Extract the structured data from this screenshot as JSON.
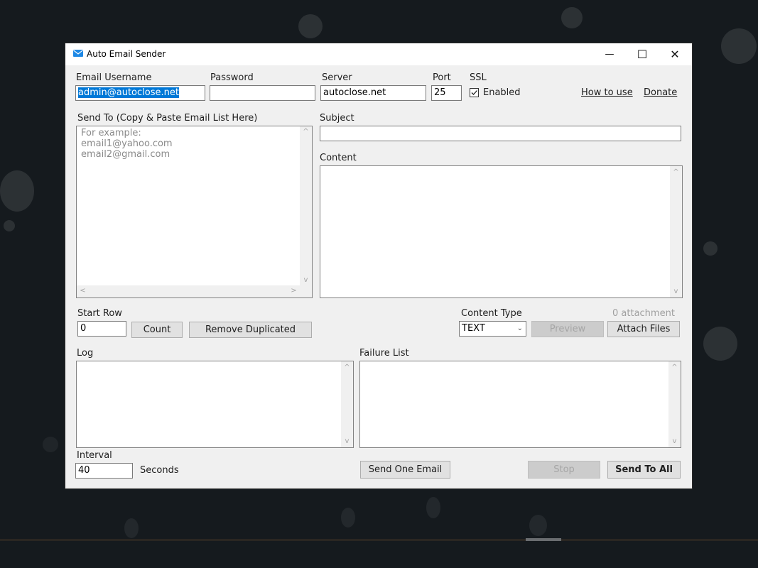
{
  "window": {
    "title": "Auto Email Sender",
    "controls": {
      "minimize": "—",
      "maximize": "☐",
      "close": "✕"
    }
  },
  "account": {
    "username_label": "Email Username",
    "username_value": "admin@autoclose.net",
    "password_label": "Password",
    "password_value": "",
    "server_label": "Server",
    "server_value": "autoclose.net",
    "port_label": "Port",
    "port_value": "25",
    "ssl_label": "SSL",
    "ssl_checkbox_label": "Enabled",
    "ssl_checked": true
  },
  "links": {
    "how_to_use": "How to use",
    "donate": "Donate"
  },
  "send_to": {
    "label": "Send To (Copy & Paste Email List Here)",
    "placeholder": "For example:\nemail1@yahoo.com\nemail2@gmail.com"
  },
  "subject": {
    "label": "Subject",
    "value": ""
  },
  "content": {
    "label": "Content",
    "value": ""
  },
  "start_row": {
    "label": "Start Row",
    "value": "0"
  },
  "buttons": {
    "count": "Count",
    "remove_duplicated": "Remove Duplicated",
    "preview": "Preview",
    "attach_files": "Attach Files",
    "send_one": "Send One Email",
    "stop": "Stop",
    "send_all": "Send To All"
  },
  "content_type": {
    "label": "Content Type",
    "selected": "TEXT"
  },
  "attachment_count": "0 attachment",
  "log": {
    "label": "Log"
  },
  "failure_list": {
    "label": "Failure List"
  },
  "interval": {
    "label": "Interval",
    "value": "40",
    "unit": "Seconds"
  },
  "scroll_glyphs": {
    "up": "^",
    "down": "v",
    "left": "<",
    "right": ">"
  },
  "colors": {
    "selection": "#0078d7",
    "app_icon": "#1e88e5"
  }
}
